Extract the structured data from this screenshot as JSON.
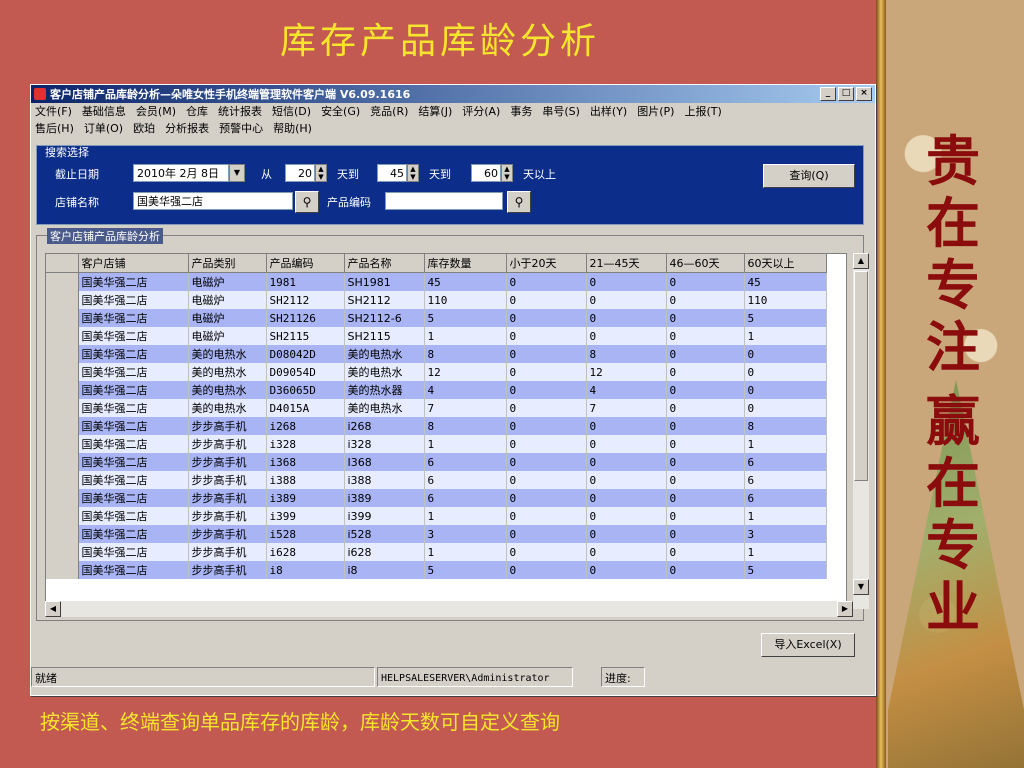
{
  "slide": {
    "title": "库存产品库龄分析",
    "caption": "按渠道、终端查询单品库存的库龄，库龄天数可自定义查询",
    "slogan": [
      "贵",
      "在",
      "专",
      "注",
      "赢",
      "在",
      "专",
      "业"
    ]
  },
  "window": {
    "title": "客户店铺产品库龄分析—朵唯女性手机终端管理软件客户端 V6.09.1616",
    "buttons": {
      "min": "_",
      "max": "□",
      "close": "×"
    }
  },
  "menu": {
    "row1": [
      "文件(F)",
      "基础信息",
      "会员(M)",
      "仓库",
      "统计报表",
      "短信(D)",
      "安全(G)",
      "竞品(R)",
      "结算(J)",
      "评分(A)",
      "事务",
      "串号(S)",
      "出样(Y)",
      "图片(P)",
      "上报(T)"
    ],
    "row2": [
      "售后(H)",
      "订单(O)",
      "欧珀",
      "分析报表",
      "预警中心",
      "帮助(H)"
    ]
  },
  "search": {
    "legend": "搜索选择",
    "date_label": "截止日期",
    "date_value": "2010年 2月 8日",
    "from_label": "从",
    "days1": "20",
    "to_label1": "天到",
    "days2": "45",
    "to_label2": "天到",
    "days3": "60",
    "above_label": "天以上",
    "query_button": "查询(Q)",
    "shop_label": "店铺名称",
    "shop_value": "国美华强二店",
    "code_label": "产品编码",
    "code_value": ""
  },
  "results": {
    "legend": "客户店铺产品库龄分析",
    "columns": [
      "客户店铺",
      "产品类别",
      "产品编码",
      "产品名称",
      "库存数量",
      "小于20天",
      "21—45天",
      "46—60天",
      "60天以上"
    ],
    "rows": [
      [
        "国美华强二店",
        "电磁炉",
        "1981",
        "SH1981",
        "45",
        "0",
        "0",
        "0",
        "45"
      ],
      [
        "国美华强二店",
        "电磁炉",
        "SH2112",
        "SH2112",
        "110",
        "0",
        "0",
        "0",
        "110"
      ],
      [
        "国美华强二店",
        "电磁炉",
        "SH21126",
        "SH2112-6",
        "5",
        "0",
        "0",
        "0",
        "5"
      ],
      [
        "国美华强二店",
        "电磁炉",
        "SH2115",
        "SH2115",
        "1",
        "0",
        "0",
        "0",
        "1"
      ],
      [
        "国美华强二店",
        "美的电热水",
        "D08042D",
        "美的电热水",
        "8",
        "0",
        "8",
        "0",
        "0"
      ],
      [
        "国美华强二店",
        "美的电热水",
        "D09054D",
        "美的电热水",
        "12",
        "0",
        "12",
        "0",
        "0"
      ],
      [
        "国美华强二店",
        "美的电热水",
        "D36065D",
        "美的热水器",
        "4",
        "0",
        "4",
        "0",
        "0"
      ],
      [
        "国美华强二店",
        "美的电热水",
        "D4015A",
        "美的电热水",
        "7",
        "0",
        "7",
        "0",
        "0"
      ],
      [
        "国美华强二店",
        "步步高手机",
        "i268",
        "i268",
        "8",
        "0",
        "0",
        "0",
        "8"
      ],
      [
        "国美华强二店",
        "步步高手机",
        "i328",
        "i328",
        "1",
        "0",
        "0",
        "0",
        "1"
      ],
      [
        "国美华强二店",
        "步步高手机",
        "i368",
        "I368",
        "6",
        "0",
        "0",
        "0",
        "6"
      ],
      [
        "国美华强二店",
        "步步高手机",
        "i388",
        "i388",
        "6",
        "0",
        "0",
        "0",
        "6"
      ],
      [
        "国美华强二店",
        "步步高手机",
        "i389",
        "i389",
        "6",
        "0",
        "0",
        "0",
        "6"
      ],
      [
        "国美华强二店",
        "步步高手机",
        "i399",
        "i399",
        "1",
        "0",
        "0",
        "0",
        "1"
      ],
      [
        "国美华强二店",
        "步步高手机",
        "i528",
        "i528",
        "3",
        "0",
        "0",
        "0",
        "3"
      ],
      [
        "国美华强二店",
        "步步高手机",
        "i628",
        "i628",
        "1",
        "0",
        "0",
        "0",
        "1"
      ],
      [
        "国美华强二店",
        "步步高手机",
        "i8",
        "i8",
        "5",
        "0",
        "0",
        "0",
        "5"
      ]
    ],
    "export_button": "导入Excel(X)"
  },
  "status": {
    "ready": "就绪",
    "server": "HELPSALESERVER\\Administrator",
    "progress_label": "进度:"
  }
}
